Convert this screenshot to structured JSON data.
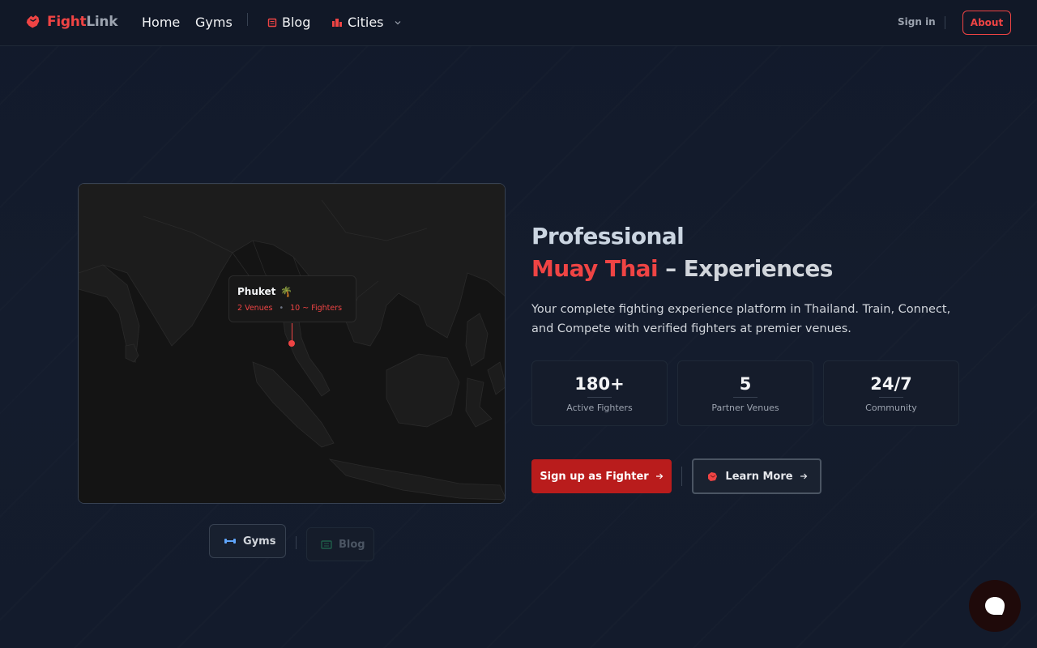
{
  "nav": {
    "logo_part1": "Fight",
    "logo_part2": "Link",
    "home": "Home",
    "gyms": "Gyms",
    "blog": "Blog",
    "cities": "Cities",
    "sign_in": "Sign in",
    "about": "About"
  },
  "map": {
    "tooltip_city": "Phuket",
    "tooltip_emoji": "🌴",
    "venues": "2 Venues",
    "separator": "•",
    "fighters": "10 ~ Fighters",
    "chip_gyms": "Gyms",
    "chip_blog": "Blog"
  },
  "hero": {
    "title_line1": "Professional",
    "title_red": "Muay Thai",
    "title_rest": " – Experiences",
    "description": "Your complete fighting experience platform in Thailand. Train, Connect, and Compete with verified fighters at premier venues.",
    "stats": [
      {
        "value": "180+",
        "label": "Active Fighters"
      },
      {
        "value": "5",
        "label": "Partner Venues"
      },
      {
        "value": "24/7",
        "label": "Community"
      }
    ],
    "primary_cta": "Sign up as Fighter",
    "secondary_cta": "Learn More"
  },
  "colors": {
    "accent": "#ef4444",
    "primary_button": "#b91c1c",
    "background": "#111827"
  }
}
